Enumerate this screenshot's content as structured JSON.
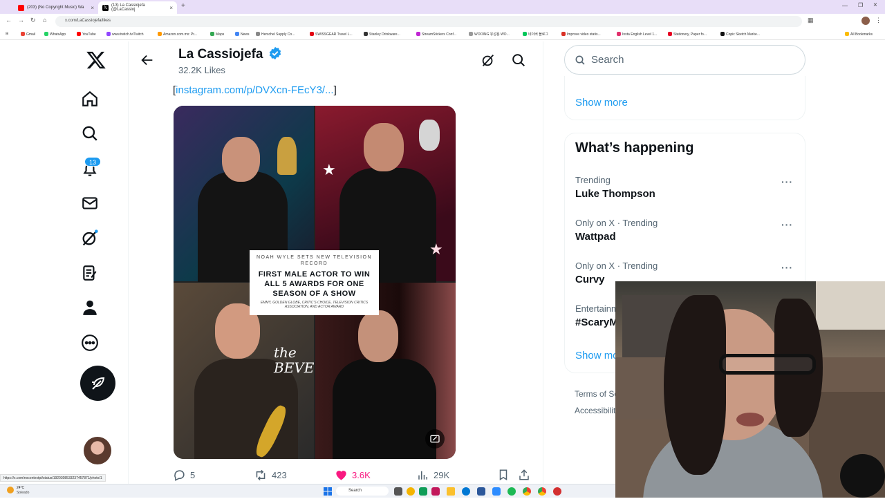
{
  "browser": {
    "tabs": [
      {
        "title": "(203) (No Copyright Music) Wa",
        "color": "#ff0000"
      },
      {
        "title": "(13) La Cassiojefa (@LaCassioj",
        "color": "#000000"
      }
    ],
    "url": "x.com/LaCassiojefa/likes",
    "bookmarks": [
      "Gmail",
      "WhatsApp",
      "YouTube",
      "www.twitch.tv/Twitch",
      "Amazon.com.mx: Pr...",
      "Maps",
      "News",
      "Herschel Supply Co...",
      "SWISSGEAR Travel L...",
      "Stanley Drinkware...",
      "StreamStickers Conf...",
      "WOOING 유성용 WO...",
      "네이버 블로그",
      "Improve video statis...",
      "Insta English Level 1...",
      "Stationery, Paper fo...",
      "Copic Sketch Marke...",
      "All Bookmarks"
    ],
    "status_url": "https://x.com/nocontextpt/status/1920308533237457871/photo/1"
  },
  "nav": {
    "notification_count": "13"
  },
  "profile": {
    "name": "La Cassiojefa",
    "likes": "32.2K Likes"
  },
  "post": {
    "link_open": "[",
    "link_text": "instagram.com/p/DVXcn-FEcY3/...",
    "link_close": "]",
    "overlay_line1": "NOAH WYLE SETS NEW TELEVISION RECORD",
    "overlay_line2": "FIRST MALE ACTOR TO WIN ALL 5 AWARDS FOR ONE SEASON OF A SHOW",
    "overlay_line3": "EMMY, GOLDEN GLOBE, CRITIC'S CHOICE, TELEVISION CRITICS ASSOCIATION, AND ACTOR AWARD",
    "sign_text": "the BEVE",
    "replies": "5",
    "reposts": "423",
    "likes": "3.6K",
    "views": "29K"
  },
  "sidebar": {
    "search_placeholder": "Search",
    "show_more_top": "Show more",
    "whats_happening": "What’s happening",
    "trends": [
      {
        "context": "Trending",
        "name": "Luke Thompson"
      },
      {
        "context": "Only on X · Trending",
        "name": "Wattpad"
      },
      {
        "context": "Only on X · Trending",
        "name": "Curvy"
      },
      {
        "context": "Entertainm",
        "name": "#ScaryM"
      }
    ],
    "show_more_bottom": "Show mo",
    "footer": [
      "Terms of Se",
      "Accessibilit"
    ]
  },
  "taskbar": {
    "weather_temp": "24°C",
    "weather_text": "Soleado",
    "search": "Search"
  },
  "colors": {
    "accent": "#1d9bf0",
    "like": "#f91880"
  }
}
